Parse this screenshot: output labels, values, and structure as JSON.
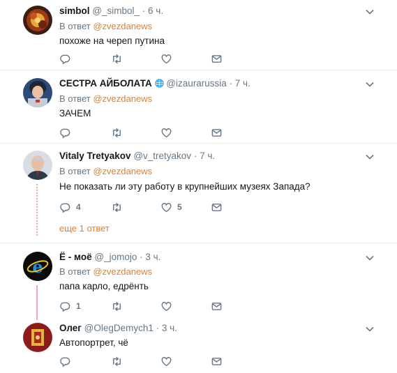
{
  "tweets": [
    {
      "name": "simbol",
      "handle": "@_simbol_",
      "time": "6 ч.",
      "reply_prefix": "В ответ",
      "reply_mention": "@zvezdanews",
      "text": "похоже на череп путина",
      "reply_count": "",
      "like_count": ""
    },
    {
      "name": "СЕСТРА АЙБОЛАТА",
      "handle": "@izaurarussia",
      "time": "7 ч.",
      "reply_prefix": "В ответ",
      "reply_mention": "@zvezdanews",
      "text": "ЗАЧЕМ",
      "reply_count": "",
      "like_count": ""
    },
    {
      "name": "Vitaly Tretyakov",
      "handle": "@v_tretyakov",
      "time": "7 ч.",
      "reply_prefix": "В ответ",
      "reply_mention": "@zvezdanews",
      "text": "Не показать ли эту работу в крупнейших музеях Запада?",
      "reply_count": "4",
      "like_count": "5"
    },
    {
      "name": "Ё - моё",
      "handle": "@_jomojo",
      "time": "3 ч.",
      "reply_prefix": "В ответ",
      "reply_mention": "@zvezdanews",
      "text": "папа карло, едрёнть",
      "reply_count": "1",
      "like_count": ""
    },
    {
      "name": "Олег",
      "handle": "@OlegDemych1",
      "time": "3 ч.",
      "reply_prefix": "",
      "reply_mention": "",
      "text": "Автопортрет, чё",
      "reply_count": "",
      "like_count": ""
    }
  ],
  "more_replies": "еще 1 ответ",
  "separator": "·",
  "icons": {
    "reply": "reply-icon",
    "retweet": "retweet-icon",
    "like": "heart-icon",
    "dm": "envelope-icon",
    "menu": "chevron-down-icon",
    "verified_globe": "globe-icon"
  },
  "colors": {
    "mention": "#e0802c",
    "meta": "#657786",
    "icon": "#657786",
    "divider": "#e6ecf0",
    "thread": "#f7a3bf"
  }
}
